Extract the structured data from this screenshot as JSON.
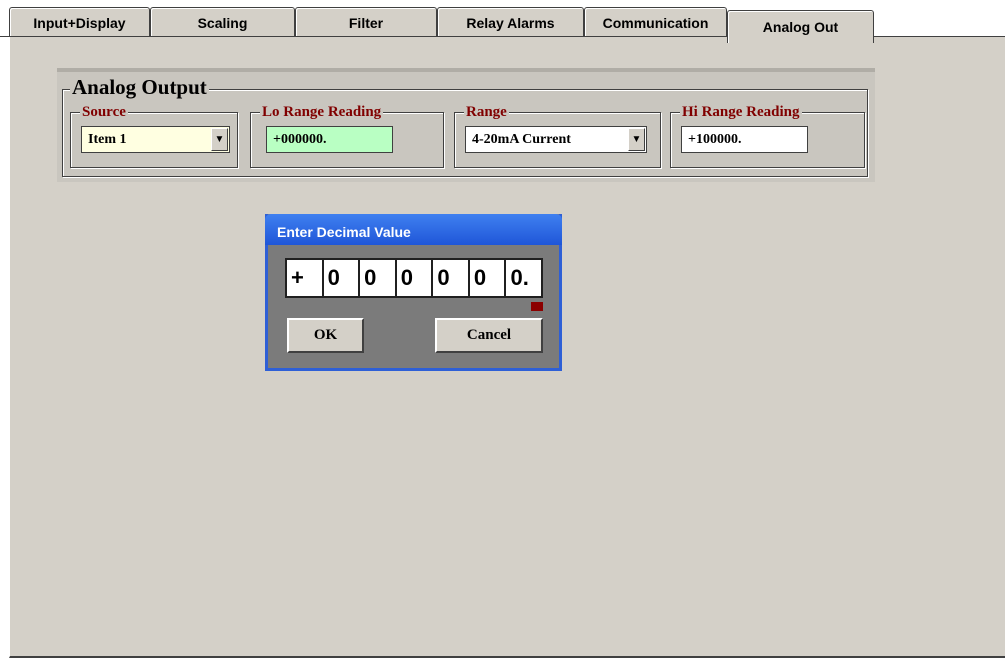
{
  "tabs": [
    {
      "label": "Input+Display",
      "active": false
    },
    {
      "label": "Scaling",
      "active": false
    },
    {
      "label": "Filter",
      "active": false
    },
    {
      "label": "Relay Alarms",
      "active": false
    },
    {
      "label": "Communication",
      "active": false
    },
    {
      "label": "Analog Out",
      "active": true
    }
  ],
  "group": {
    "title": "Analog Output",
    "source": {
      "label": "Source",
      "value": "Item 1"
    },
    "lo_range": {
      "label": "Lo Range Reading",
      "value": "+000000."
    },
    "range": {
      "label": "Range",
      "value": "4-20mA Current"
    },
    "hi_range": {
      "label": "Hi Range Reading",
      "value": "+100000."
    }
  },
  "dialog": {
    "title": "Enter Decimal Value",
    "digits": [
      "+",
      "0",
      "0",
      "0",
      "0",
      "0",
      "0."
    ],
    "ok_label": "OK",
    "cancel_label": "Cancel"
  },
  "colors": {
    "label_red": "#800000",
    "source_bg": "#ffffe1",
    "lo_range_bg": "#b9ffc3",
    "titlebar_blue": "#2a62e0",
    "cursor_red": "#8b0000"
  }
}
